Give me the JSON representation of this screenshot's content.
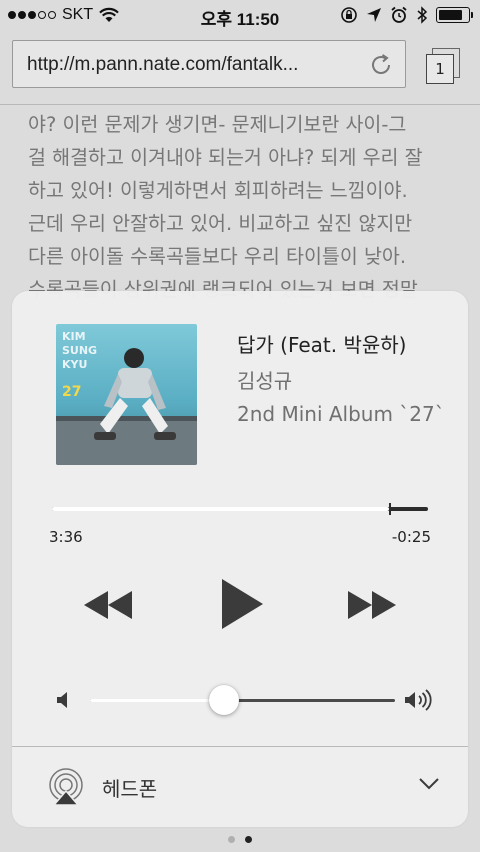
{
  "status_bar": {
    "carrier": "SKT",
    "signal_bars_filled": 3,
    "signal_bars_total": 5,
    "time": "오후 11:50",
    "battery_level": 0.85
  },
  "browser": {
    "url": "http://m.pann.nate.com/fantalk...",
    "tab_count": "1",
    "article_lines": [
      "야? 이런 문제가 생기면- 문제니기보란 사이-그",
      "걸 해결하고 이겨내야 되는거 아냐? 되게 우리 잘",
      "하고 있어! 이렇게하면서 회피하려는 느낌이야.",
      "근데 우리 안잘하고 있어. 비교하고 싶진 않지만",
      "다른 아이돌 수록곡들보다 우리 타이틀이 낮아.",
      "수록곡들이 상위권에 랭크되어 있는거 보면 정말"
    ]
  },
  "player": {
    "artwork_text": {
      "line1": "KIM",
      "line2": "SUNG",
      "line3": "KYU",
      "number": "27"
    },
    "title": "답가 (Feat. 박윤하)",
    "artist": "김성규",
    "album": "2nd Mini Album `27`",
    "elapsed": "3:36",
    "remaining": "-0:25",
    "progress": 0.896,
    "volume": 0.44,
    "output_device": "헤드폰"
  },
  "icons": {
    "rewind": "rewind-icon",
    "play": "play-icon",
    "fast_forward": "fast-forward-icon",
    "volume_low": "speaker-low-icon",
    "volume_high": "speaker-high-icon",
    "airplay": "airplay-icon",
    "chevron": "chevron-down-icon",
    "reload": "reload-icon"
  },
  "page_indicator": {
    "count": 2,
    "active_index": 1
  }
}
